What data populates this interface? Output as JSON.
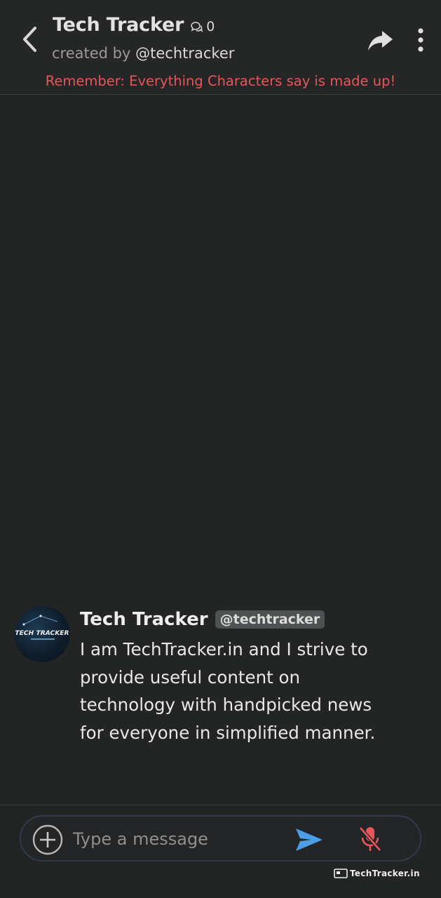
{
  "header": {
    "title": "Tech Tracker",
    "chat_count": "0",
    "created_by_label": "created by",
    "creator_handle": "@techtracker",
    "notice": "Remember: Everything Characters say is made up!",
    "icons": [
      "back-arrow-icon",
      "chat-bubbles-icon",
      "share-icon",
      "more-vertical-icon"
    ]
  },
  "message": {
    "author_name": "Tech Tracker",
    "author_handle": "@techtracker",
    "avatar_text": "TECH TRACKER",
    "text": "I am TechTracker.in and I strive to provide useful content on technology with handpicked news for everyone in simplified manner."
  },
  "composer": {
    "placeholder": "Type a message",
    "value": "",
    "icons": [
      "plus-circle-icon",
      "send-icon",
      "mic-off-icon"
    ]
  },
  "watermark": {
    "text": "TechTracker.in"
  },
  "colors": {
    "background": "#232424",
    "notice": "#e5575c",
    "send": "#4a9fe8",
    "mic_off": "#e5575c"
  }
}
